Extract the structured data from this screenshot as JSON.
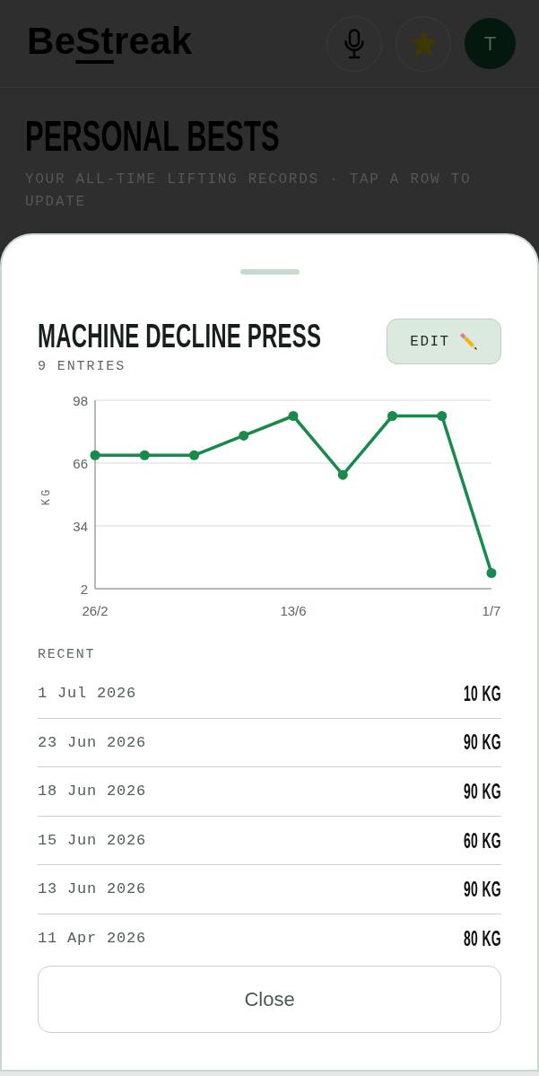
{
  "header": {
    "logo": {
      "before": "Be",
      "underlined": "St",
      "after": "reak"
    },
    "avatar": "T"
  },
  "page": {
    "title": "PERSONAL BESTS",
    "subtitle": "YOUR ALL-TIME LIFTING RECORDS · TAP A ROW TO UPDATE"
  },
  "sheet": {
    "title": "MACHINE DECLINE PRESS",
    "entry_count": "9 ENTRIES",
    "edit_button": "EDIT",
    "chart": {
      "chart_data": {
        "type": "line",
        "ylabel": "KG",
        "categories": [
          "26/2",
          null,
          null,
          null,
          "13/6",
          null,
          null,
          null,
          "1/7"
        ],
        "ylim": [
          2,
          98
        ],
        "yticks": [
          2,
          34,
          66,
          98
        ],
        "series": [
          {
            "color": "#178a4c",
            "marker": "circle",
            "values": [
              70,
              70,
              70,
              80,
              90,
              60,
              90,
              90,
              10
            ]
          }
        ]
      }
    },
    "recent": {
      "heading": "RECENT",
      "entries": [
        {
          "date": "1 Jul 2026",
          "weight": "10 KG"
        },
        {
          "date": "23 Jun 2026",
          "weight": "90 KG"
        },
        {
          "date": "18 Jun 2026",
          "weight": "90 KG"
        },
        {
          "date": "15 Jun 2026",
          "weight": "60 KG"
        },
        {
          "date": "13 Jun 2026",
          "weight": "90 KG"
        },
        {
          "date": "11 Apr 2026",
          "weight": "80 KG"
        }
      ]
    },
    "close_button": "Close"
  }
}
